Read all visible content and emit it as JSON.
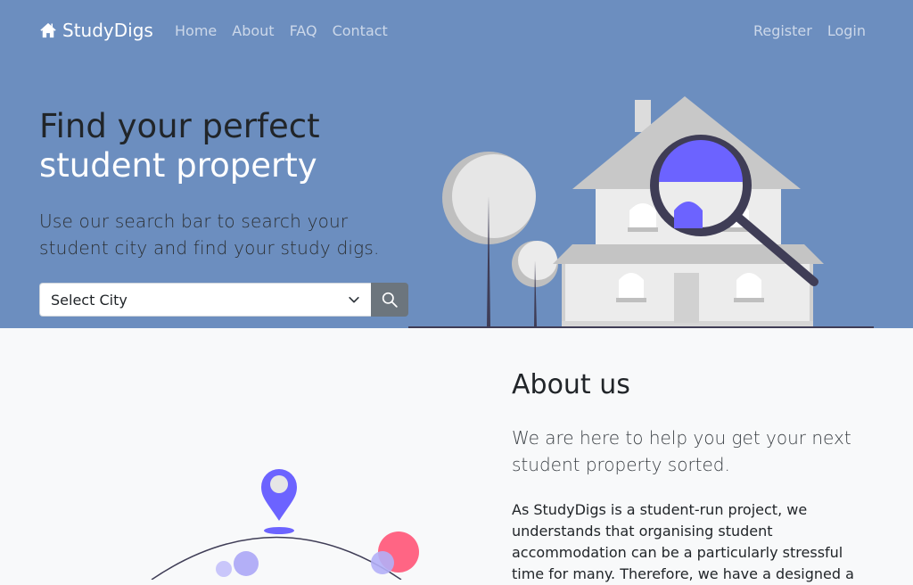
{
  "navbar": {
    "brand": "StudyDigs",
    "brand_icon": "house-icon",
    "links": [
      "Home",
      "About",
      "FAQ",
      "Contact"
    ],
    "right_links": [
      "Register",
      "Login"
    ]
  },
  "hero": {
    "title_line1": "Find your perfect",
    "title_line2": "student property",
    "lead": "Use our search bar to search your student city and find your study digs.",
    "select_value": "Select City",
    "search_icon": "search-icon"
  },
  "about": {
    "title": "About us",
    "lead": "We are here to help you get your next student property sorted.",
    "body": "As StudyDigs is a student-run project, we understands that organising student accommodation can be a particularly stressful time for many. Therefore, we have a designed a"
  },
  "colors": {
    "hero_bg": "#6c8ebf",
    "accent": "#6c63ff",
    "pink": "#ff6584",
    "search_button": "#6c757d"
  }
}
